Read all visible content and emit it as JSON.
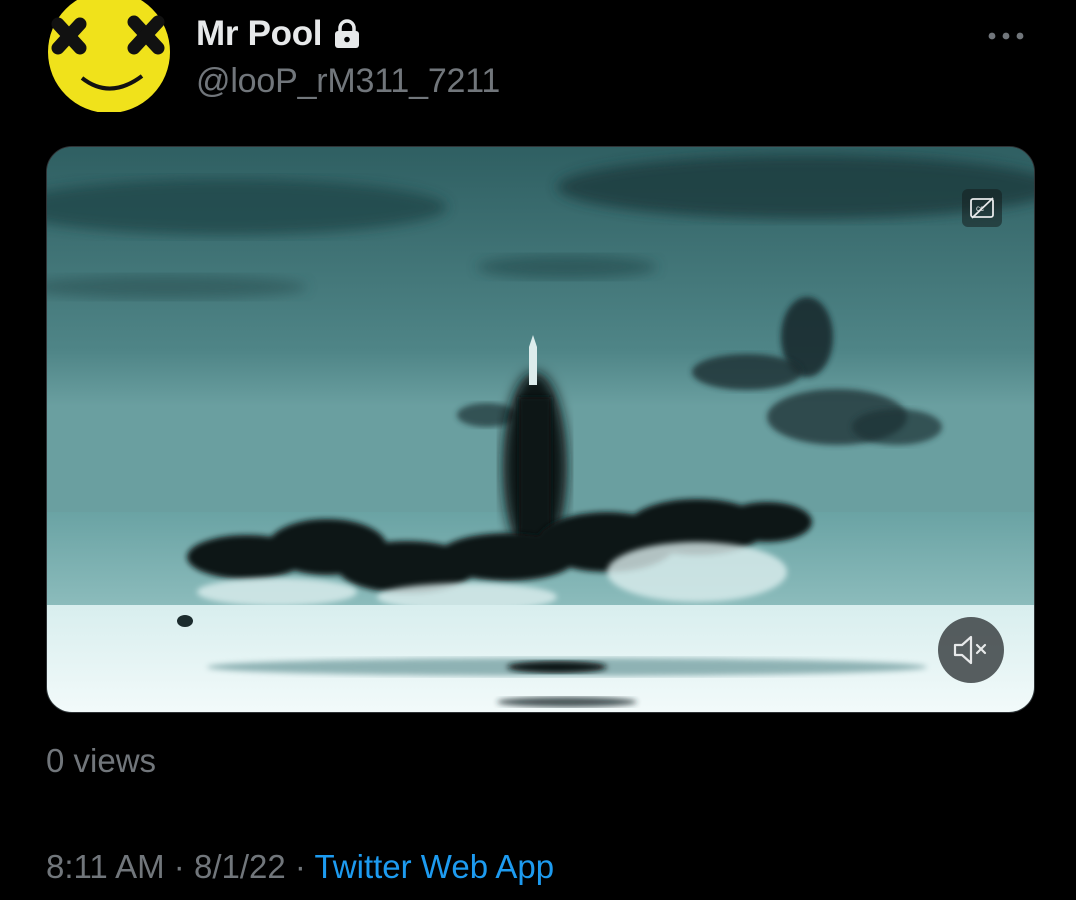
{
  "tweet": {
    "author": {
      "display_name": "Mr Pool",
      "handle": "@looP_rM311_7211",
      "avatar_icon": "yellow-smiley-x-eyes-avatar",
      "protected_icon": "lock-icon"
    },
    "more_icon": "more-dots-icon",
    "media": {
      "type": "video",
      "captions_icon": "closed-captions-off-icon",
      "mute_icon": "volume-muted-icon"
    },
    "views": "0 views",
    "time": "8:11 AM",
    "separator_1": " · ",
    "date": "8/1/22",
    "separator_2": " · ",
    "source": "Twitter Web App"
  },
  "colors": {
    "background": "#000000",
    "primary_text": "#e7e9ea",
    "secondary_text": "#71767b",
    "link": "#1d9bf0",
    "avatar_yellow": "#f0e21b"
  }
}
